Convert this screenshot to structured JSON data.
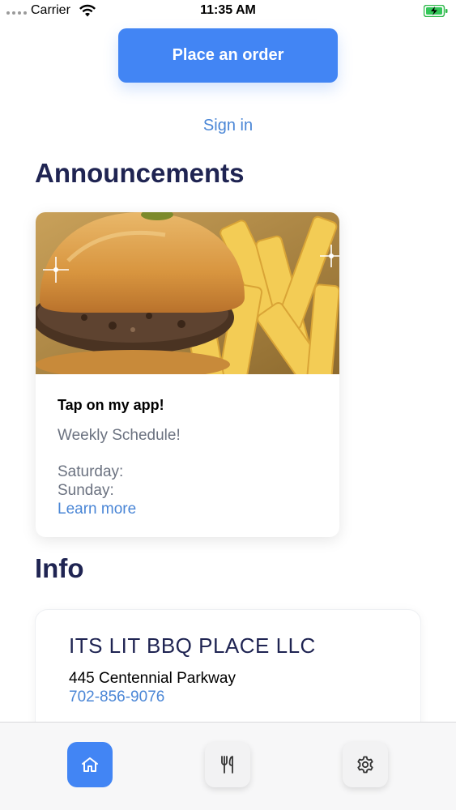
{
  "status_bar": {
    "carrier": "Carrier",
    "time": "11:35 AM",
    "icons": [
      "signal-dots-icon",
      "wifi-icon",
      "battery-charging-icon"
    ]
  },
  "actions": {
    "place_order_label": "Place an order",
    "sign_in_label": "Sign in"
  },
  "announcements": {
    "title": "Announcements",
    "card": {
      "image": "burger-and-fries-photo",
      "heading": "Tap on my app!",
      "subtitle": "Weekly Schedule!",
      "lines": [
        "Saturday:",
        "Sunday:"
      ],
      "learn_more_label": "Learn more"
    }
  },
  "info": {
    "title": "Info",
    "business_name": "ITS LIT BBQ PLACE LLC",
    "address": "445 Centennial Parkway",
    "phone": "702-856-9076"
  },
  "tab_bar": {
    "tabs": [
      {
        "icon": "home-icon",
        "active": true
      },
      {
        "icon": "fork-knife-icon",
        "active": false
      },
      {
        "icon": "gear-icon",
        "active": false
      }
    ]
  },
  "colors": {
    "accent": "#4285f4",
    "link": "#4a86d6",
    "heading": "#1f2452",
    "muted": "#6b7280"
  }
}
